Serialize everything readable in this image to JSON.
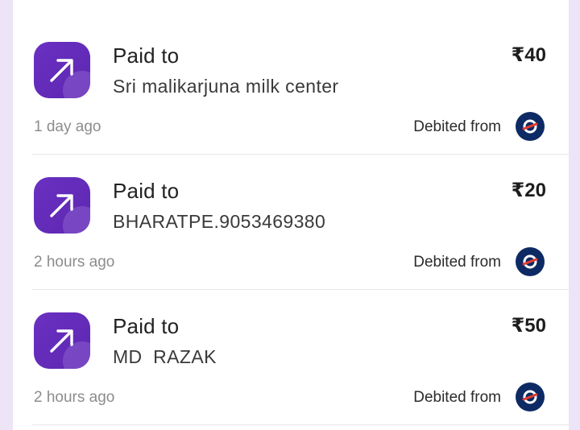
{
  "transactions": [
    {
      "title": "Paid to",
      "payee": "Sri malikarjuna milk center",
      "amount": "₹40",
      "time": "1 day ago",
      "debited_label": "Debited from",
      "icon": "arrow-up-right-icon",
      "bank_icon": "bank-logo-icon"
    },
    {
      "title": "Paid to",
      "payee": "BHARATPE.9053469380",
      "amount": "₹20",
      "time": "2 hours ago",
      "debited_label": "Debited from",
      "icon": "arrow-up-right-icon",
      "bank_icon": "bank-logo-icon"
    },
    {
      "title": "Paid to",
      "payee": "MD  RAZAK",
      "amount": "₹50",
      "time": "2 hours ago",
      "debited_label": "Debited from",
      "icon": "arrow-up-right-icon",
      "bank_icon": "bank-logo-icon"
    }
  ],
  "colors": {
    "background": "#ede4f7",
    "card": "#ffffff",
    "icon_tile": "#6a30c2",
    "bank_logo_bg": "#0d2a64",
    "bank_logo_accent": "#e63a2e",
    "muted_text": "#8c8c8c"
  }
}
